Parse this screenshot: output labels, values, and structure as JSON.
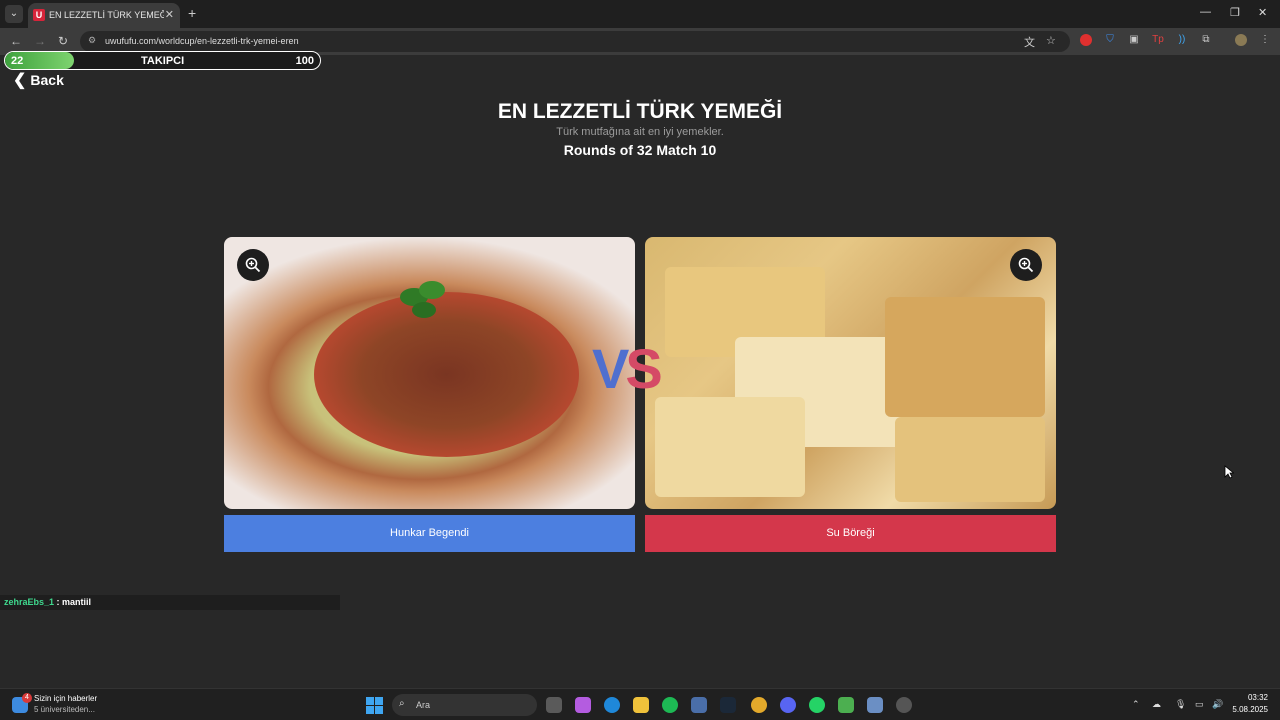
{
  "browser": {
    "tab_title": "EN LEZZETLİ TÜRK YEMEĞİ | Uw",
    "favicon_letter": "U",
    "url": "uwufufu.com/worldcup/en-lezzetli-trk-yemei-eren"
  },
  "progress": {
    "start_value": "22",
    "label": "TAKIPCI",
    "end_value": "100",
    "fill_fraction": 0.22
  },
  "nav": {
    "back_label": "Back"
  },
  "header": {
    "title": "EN LEZZETLİ TÜRK YEMEĞİ",
    "subtitle": "Türk mutfağına ait en iyi yemekler.",
    "round_info": "Rounds of 32 Match 10"
  },
  "vs": {
    "v": "V",
    "s": "S"
  },
  "choices": {
    "left": {
      "label": "Hunkar Begendi",
      "color": "#4c7fe0"
    },
    "right": {
      "label": "Su Böreği",
      "color": "#d4374b"
    }
  },
  "chat": {
    "user": "zehraEbs_1",
    "separator": " : ",
    "message": "mantiil"
  },
  "taskbar": {
    "news_badge": "4",
    "news_title": "Sizin için haberler",
    "news_subtitle": "5 üniversiteden...",
    "search_placeholder": "Ara",
    "time": "03:32",
    "date": "5.08.2025"
  }
}
